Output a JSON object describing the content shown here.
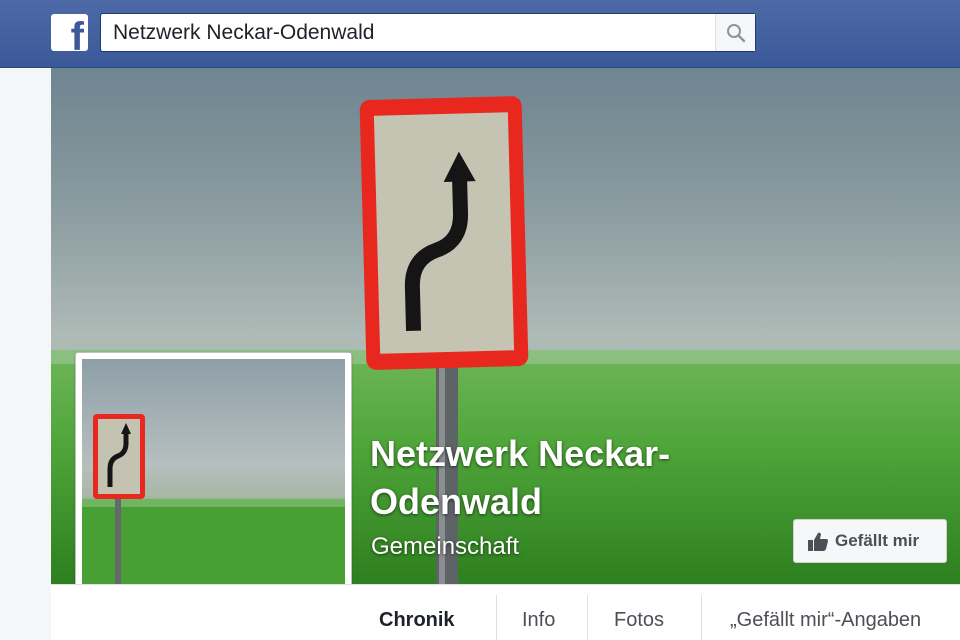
{
  "header": {
    "logo_glyph": "f",
    "search": {
      "value": "Netzwerk Neckar-Odenwald",
      "placeholder": ""
    }
  },
  "page": {
    "name_line1": "Netzwerk Neckar-",
    "name_line2": "Odenwald",
    "category": "Gemeinschaft",
    "like_label": "Gefällt mir"
  },
  "tabs": [
    {
      "label": "Chronik",
      "active": true
    },
    {
      "label": "Info"
    },
    {
      "label": "Fotos"
    },
    {
      "label": "„Gefällt mir“-Angaben"
    }
  ],
  "colors": {
    "brand": "#3b5998",
    "sign_border": "#e8281f",
    "grass": "#3f8f29"
  },
  "icons": [
    "facebook-logo-icon",
    "search-icon",
    "thumbs-up-icon"
  ]
}
